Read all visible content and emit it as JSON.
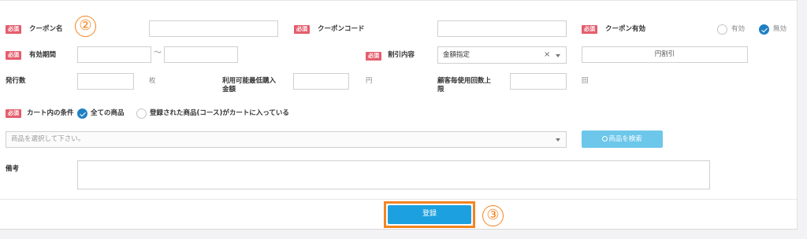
{
  "required_badge": "必須",
  "annotations": {
    "step2": "②",
    "step3": "③"
  },
  "row1": {
    "coupon_name_label": "クーポン名",
    "coupon_code_label": "クーポンコード",
    "coupon_valid_label": "クーポン有効",
    "valid_on": "有効",
    "valid_off": "無効",
    "selected": "無効"
  },
  "row2": {
    "period_label": "有効期間",
    "period_sep": "〜",
    "discount_label": "割引内容",
    "discount_select_value": "金額指定",
    "clear_symbol": "×",
    "discount_amount_placeholder": "円割引"
  },
  "row3": {
    "issue_count_label": "発行数",
    "issue_unit": "枚",
    "min_purchase_label": "利用可能最低購入金額",
    "min_purchase_unit": "円",
    "per_customer_label": "顧客毎使用回数上限",
    "per_customer_unit": "回"
  },
  "row4": {
    "cart_condition_label": "カート内の条件",
    "option_all": "全ての商品",
    "option_registered": "登録された商品(コース)がカートに入っている",
    "selected": "全ての商品"
  },
  "row5": {
    "product_select_placeholder": "商品を選択して下さい。",
    "search_button": "商品を検索"
  },
  "row6": {
    "remarks_label": "備考"
  },
  "footer": {
    "submit_label": "登録"
  },
  "colors": {
    "required": "#e45d6c",
    "accent": "#f5841f",
    "primary": "#1da0df",
    "search": "#6cc7ea",
    "check": "#1f7fc4"
  }
}
